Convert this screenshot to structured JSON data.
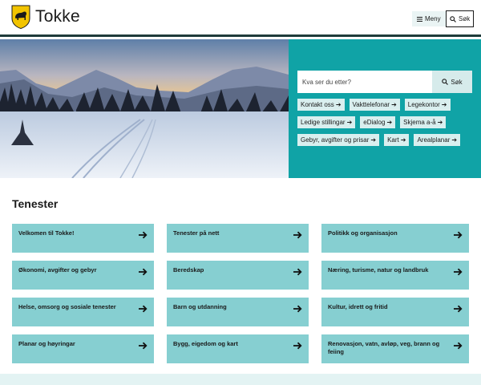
{
  "header": {
    "site_name": "Tokke",
    "menu_label": "Meny",
    "search_label": "Søk",
    "icons": {
      "crest": "bear-crest-icon",
      "menu": "hamburger-icon",
      "search": "search-icon"
    }
  },
  "hero": {
    "image": "winter-landscape-ski-tracks",
    "search": {
      "placeholder": "Kva ser du etter?",
      "button_label": "Søk"
    },
    "quick_links": [
      {
        "label": "Kontakt oss"
      },
      {
        "label": "Vakttelefonar"
      },
      {
        "label": "Legekontor"
      },
      {
        "label": "Ledige stillingar"
      },
      {
        "label": "eDialog"
      },
      {
        "label": "Skjema a-å"
      },
      {
        "label": "Gebyr, avgifter og prisar"
      },
      {
        "label": "Kart"
      },
      {
        "label": "Arealplanar"
      }
    ],
    "quick_link_arrow": "➔"
  },
  "services": {
    "title": "Tenester",
    "items": [
      {
        "label": "Velkomen til Tokke!"
      },
      {
        "label": "Tenester på nett"
      },
      {
        "label": "Politikk og organisasjon"
      },
      {
        "label": "Økonomi, avgifter og gebyr"
      },
      {
        "label": "Beredskap"
      },
      {
        "label": "Næring, turisme, natur og landbruk"
      },
      {
        "label": "Helse, omsorg og sosiale tenester"
      },
      {
        "label": "Barn og utdanning"
      },
      {
        "label": "Kultur, idrett og fritid"
      },
      {
        "label": "Planar og høyringar"
      },
      {
        "label": "Bygg, eigedom og kart"
      },
      {
        "label": "Renovasjon, vatn, avløp, veg, brann og feiing"
      }
    ]
  },
  "colors": {
    "accent_teal": "#10a3a6",
    "tile_teal": "#86cfd1",
    "chip_bg": "#d9efef",
    "crest_yellow": "#f2c400",
    "header_border": "#1f3b3a"
  }
}
